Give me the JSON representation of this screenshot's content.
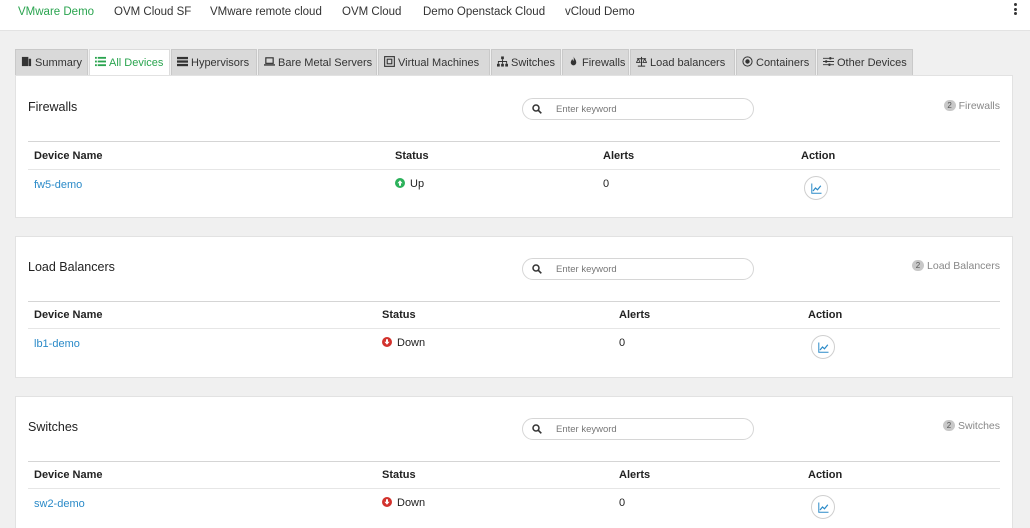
{
  "colors": {
    "accent": "#2aa44f",
    "link": "#2a8ac8",
    "status_up": "#2bb15a",
    "status_down": "#d2322d"
  },
  "cloud_tabs": [
    {
      "label": "VMware Demo",
      "active": true
    },
    {
      "label": "OVM Cloud SF"
    },
    {
      "label": "VMware remote cloud"
    },
    {
      "label": "OVM Cloud"
    },
    {
      "label": "Demo Openstack Cloud"
    },
    {
      "label": "vCloud Demo"
    }
  ],
  "device_tabs": [
    {
      "label": "Summary",
      "icon": "summary-icon"
    },
    {
      "label": "All Devices",
      "icon": "list-icon",
      "active": true
    },
    {
      "label": "Hypervisors",
      "icon": "server-icon"
    },
    {
      "label": "Bare Metal Servers",
      "icon": "laptop-icon"
    },
    {
      "label": "Virtual Machines",
      "icon": "vm-icon"
    },
    {
      "label": "Switches",
      "icon": "sitemap-icon"
    },
    {
      "label": "Firewalls",
      "icon": "flame-icon"
    },
    {
      "label": "Load balancers",
      "icon": "balance-scale-icon"
    },
    {
      "label": "Containers",
      "icon": "container-icon"
    },
    {
      "label": "Other Devices",
      "icon": "sliders-icon"
    }
  ],
  "search_placeholder": "Enter keyword",
  "columns": {
    "device_name": "Device Name",
    "status": "Status",
    "alerts": "Alerts",
    "action": "Action"
  },
  "panels": [
    {
      "title": "Firewalls",
      "count": "2",
      "count_label": "Firewalls",
      "rows": [
        {
          "name": "fw5-demo",
          "status": "Up",
          "alerts": "0",
          "action_icon": "chart-line-icon"
        }
      ]
    },
    {
      "title": "Load Balancers",
      "count": "2",
      "count_label": "Load Balancers",
      "rows": [
        {
          "name": "lb1-demo",
          "status": "Down",
          "alerts": "0",
          "action_icon": "chart-line-icon"
        }
      ]
    },
    {
      "title": "Switches",
      "count": "2",
      "count_label": "Switches",
      "rows": [
        {
          "name": "sw2-demo",
          "status": "Down",
          "alerts": "0",
          "action_icon": "chart-line-icon"
        }
      ]
    }
  ]
}
